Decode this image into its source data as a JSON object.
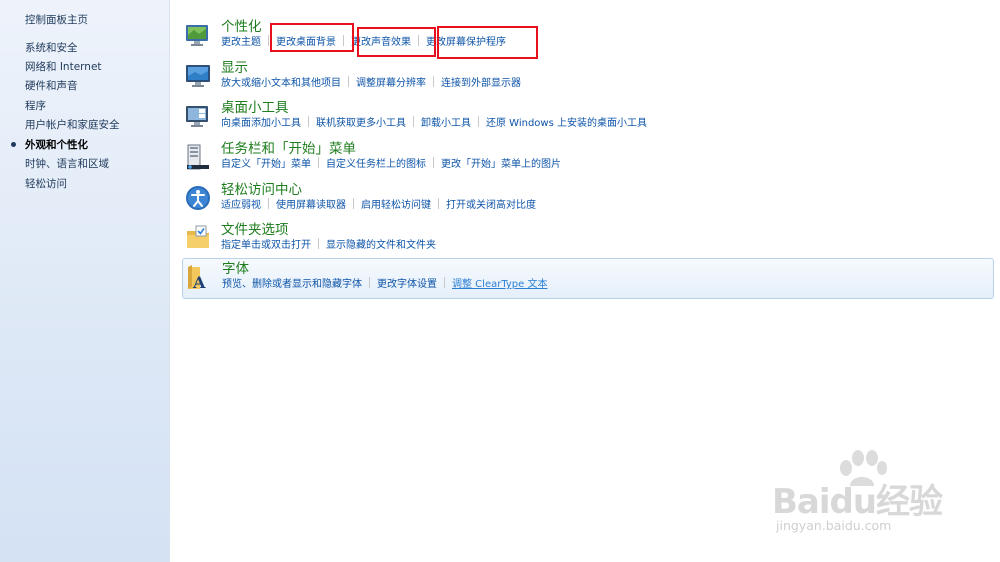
{
  "sidebar": {
    "items": [
      {
        "label": "控制面板主页"
      },
      {
        "label": "系统和安全"
      },
      {
        "label": "网络和 Internet"
      },
      {
        "label": "硬件和声音"
      },
      {
        "label": "程序"
      },
      {
        "label": "用户帐户和家庭安全"
      },
      {
        "label": "外观和个性化",
        "current": true
      },
      {
        "label": "时钟、语言和区域"
      },
      {
        "label": "轻松访问"
      }
    ]
  },
  "categories": [
    {
      "title": "个性化",
      "icon": "personalization-icon",
      "links": [
        "更改主题",
        "更改桌面背景",
        "更改声音效果",
        "更改屏幕保护程序"
      ]
    },
    {
      "title": "显示",
      "icon": "display-icon",
      "links": [
        "放大或缩小文本和其他项目",
        "调整屏幕分辨率",
        "连接到外部显示器"
      ]
    },
    {
      "title": "桌面小工具",
      "icon": "gadgets-icon",
      "links": [
        "向桌面添加小工具",
        "联机获取更多小工具",
        "卸载小工具",
        "还原 Windows 上安装的桌面小工具"
      ]
    },
    {
      "title": "任务栏和「开始」菜单",
      "icon": "taskbar-icon",
      "links": [
        "自定义「开始」菜单",
        "自定义任务栏上的图标",
        "更改「开始」菜单上的图片"
      ]
    },
    {
      "title": "轻松访问中心",
      "icon": "ease-of-access-icon",
      "links": [
        "适应弱视",
        "使用屏幕读取器",
        "启用轻松访问键",
        "打开或关闭高对比度"
      ]
    },
    {
      "title": "文件夹选项",
      "icon": "folder-options-icon",
      "links": [
        "指定单击或双击打开",
        "显示隐藏的文件和文件夹"
      ]
    },
    {
      "title": "字体",
      "icon": "fonts-icon",
      "links": [
        "预览、删除或者显示和隐藏字体",
        "更改字体设置",
        "调整 ClearType 文本"
      ]
    }
  ],
  "watermark": {
    "main": "Baidu经验",
    "sub": "jingyan.baidu.com"
  },
  "colors": {
    "title_green": "#1e7d1e",
    "link_blue": "#0d54a8",
    "highlight_red": "#e8101d"
  }
}
